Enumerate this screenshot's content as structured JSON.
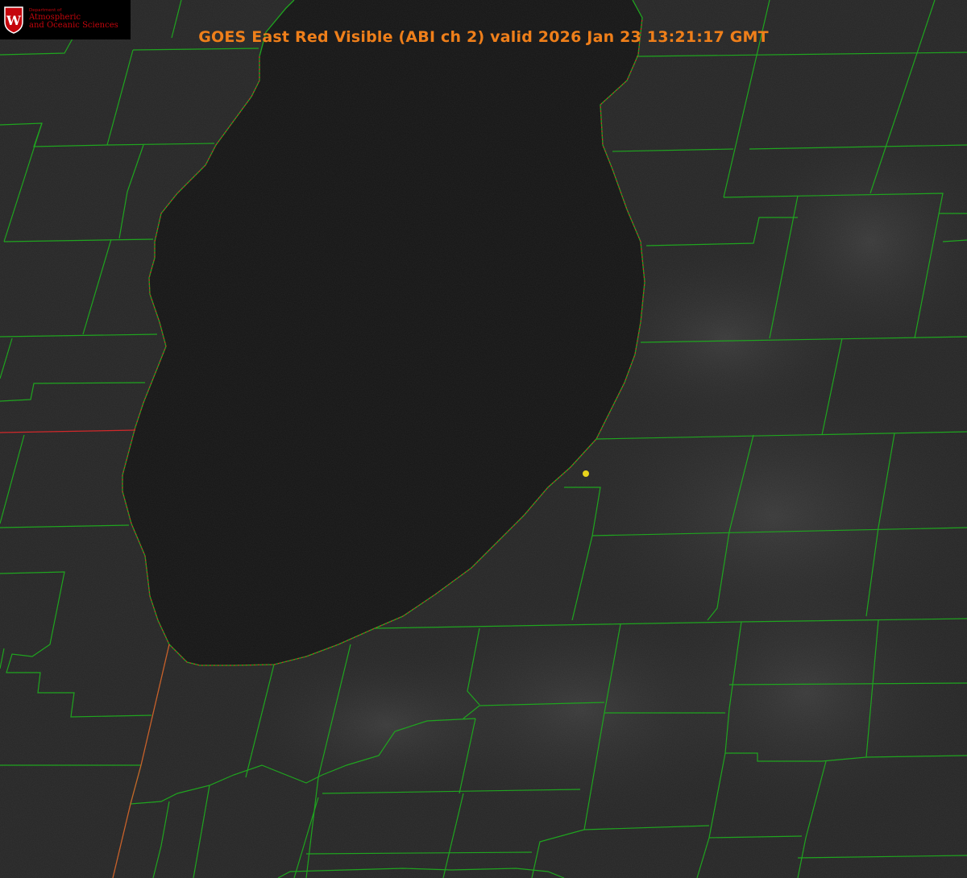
{
  "title": "GOES East Red Visible (ABI ch 2) valid 2026 Jan 23 13:21:17 GMT",
  "logo": {
    "department": "Department of",
    "line1": "Atmospheric",
    "line2": "and Oceanic Sciences",
    "crest_letter": "W"
  },
  "colors": {
    "title": "#ef7f1a",
    "county_lines": "#1fa51f",
    "state_border": "#d2282a",
    "marker": "#e8d31c",
    "lake": "#141414",
    "land": "#2a2a2a",
    "logo_red": "#c5050c"
  },
  "layers": [
    "county-boundaries",
    "state-boundaries",
    "lake-shoreline",
    "location-marker"
  ]
}
